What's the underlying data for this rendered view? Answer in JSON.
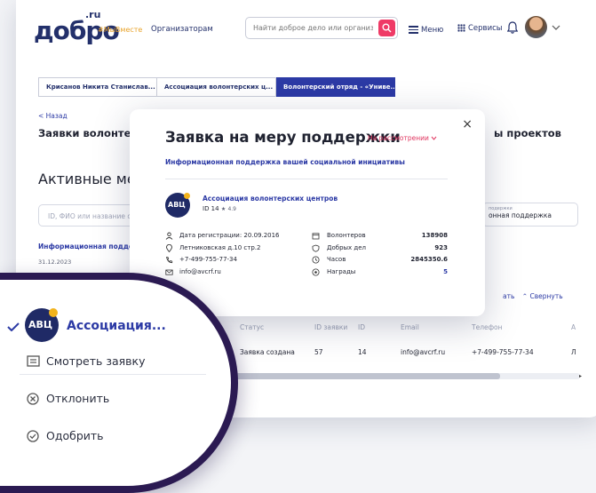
{
  "header": {
    "logo_text": "добро",
    "logo_sup": ".ru",
    "hashtag": "#МыВместе",
    "organizers_link": "Организаторам",
    "search_placeholder": "Найти доброе дело или организацию",
    "menu_label": "Меню",
    "services_label": "Сервисы"
  },
  "tabs": [
    {
      "label": "Крисанов Никита Станислав...",
      "active": false
    },
    {
      "label": "Ассоциация волонтерских ц...",
      "active": false
    },
    {
      "label": "Волонтерский отряд - «Униве...",
      "active": true
    }
  ],
  "page": {
    "back_label": "< Назад",
    "title_left": "Заявки волонтеро",
    "title_right": "ы проектов",
    "section_title": "Активные мер",
    "filter_placeholder": "ID, ФИО или название ор",
    "support_select_label": "подержки",
    "support_select_value": "онная поддержка",
    "info_link": "Информационная подде",
    "date": "31.12.2023",
    "collapse_left": "ать",
    "collapse_label": "Свернуть"
  },
  "table": {
    "headers": [
      "Статус",
      "ID заявки",
      "ID",
      "Email",
      "Телефон",
      "А"
    ],
    "row": [
      "Заявка создана",
      "57",
      "14",
      "info@avcrf.ru",
      "+7-499-755-77-34",
      "Л"
    ]
  },
  "modal": {
    "title": "Заявка на меру поддержки",
    "status": "На рассмотрении",
    "subtitle": "Информационная поддержка вашей социальной инициативы",
    "close": "×",
    "org_logo_text": "АВЦ",
    "org_name": "Ассоциация волонтерских центров",
    "org_id": "ID 14",
    "org_rating": "4.9",
    "left_info": [
      "Дата регистрации: 20.09.2016",
      "Летниковская д.10 стр.2",
      "+7-499-755-77-34",
      "info@avcrf.ru"
    ],
    "right_info": [
      {
        "label": "Волонтеров",
        "value": "138908"
      },
      {
        "label": "Добрых дел",
        "value": "923"
      },
      {
        "label": "Часов",
        "value": "2845350.6"
      },
      {
        "label": "Награды",
        "value": "5"
      }
    ]
  },
  "magnifier": {
    "logo_text": "АВЦ",
    "org_name": "Ассоциация...",
    "actions": [
      "Смотреть заявку",
      "Отклонить",
      "Одобрить"
    ]
  },
  "colors": {
    "brand": "#23306b",
    "link": "#2c3aa5",
    "accent": "#ef3a66",
    "hashtag": "#e8a32a",
    "magnifier_ring": "#2b1a52"
  }
}
